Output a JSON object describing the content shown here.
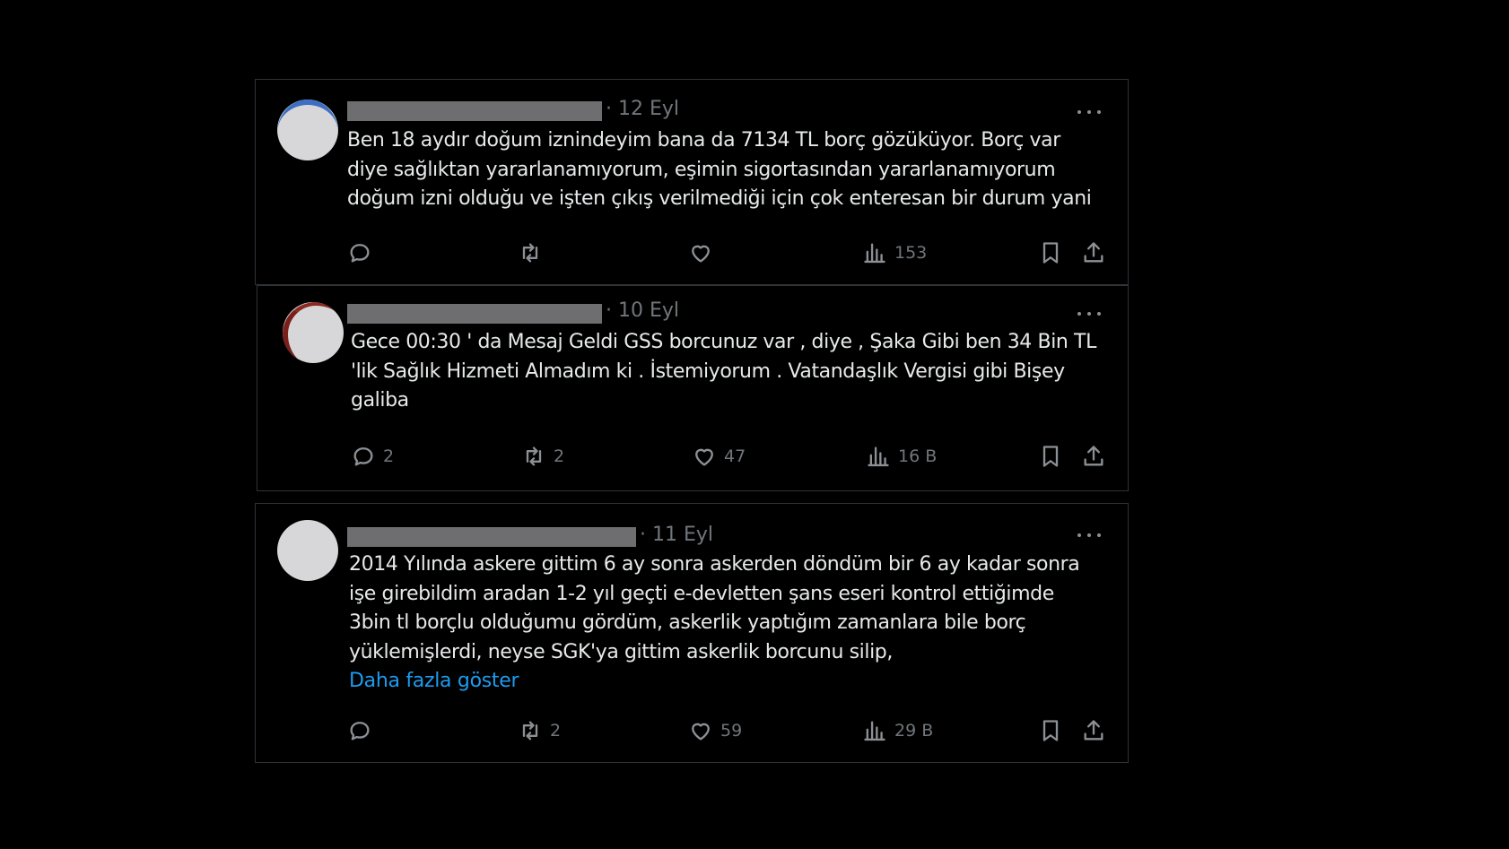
{
  "tweets": [
    {
      "date": "· 12 Eyl",
      "text": "Ben 18 aydır doğum iznindeyim bana da 7134 TL borç gözüküyor. Borç var\ndiye sağlıktan yararlanamıyorum, eşimin sigortasından yararlanamıyorum\ndoğum izni olduğu ve işten çıkış verilmediği için çok enteresan bir durum yani",
      "show_more": "",
      "replies": "",
      "retweets": "",
      "likes": "",
      "views": "153"
    },
    {
      "date": "· 10 Eyl",
      "text": "Gece 00:30 ' da Mesaj Geldi GSS borcunuz var , diye , Şaka Gibi ben 34 Bin TL\n'lik Sağlık Hizmeti Almadım ki . İstemiyorum . Vatandaşlık Vergisi gibi Bişey\ngaliba",
      "show_more": "",
      "replies": "2",
      "retweets": "2",
      "likes": "47",
      "views": "16 B"
    },
    {
      "date": "· 11 Eyl",
      "text": "2014 Yılında askere gittim 6 ay sonra askerden döndüm bir 6 ay kadar sonra\nişe girebildim aradan 1-2 yıl geçti e-devletten şans eseri kontrol ettiğimde\n3bin tl borçlu olduğumu gördüm, askerlik yaptığım zamanlara bile borç\nyüklemişlerdi, neyse SGK'ya gittim askerlik borcunu silip,",
      "show_more": "Daha fazla göster",
      "replies": "",
      "retweets": "2",
      "likes": "59",
      "views": "29 B"
    }
  ],
  "colors": {
    "background": "#000000",
    "text": "#e7e9ea",
    "muted": "#71767b",
    "link": "#1d9bf0",
    "border": "#2f3336",
    "redaction": "#6e6e70"
  },
  "icons": [
    "reply-icon",
    "retweet-icon",
    "like-icon",
    "views-icon",
    "bookmark-icon",
    "share-icon",
    "more-icon"
  ]
}
